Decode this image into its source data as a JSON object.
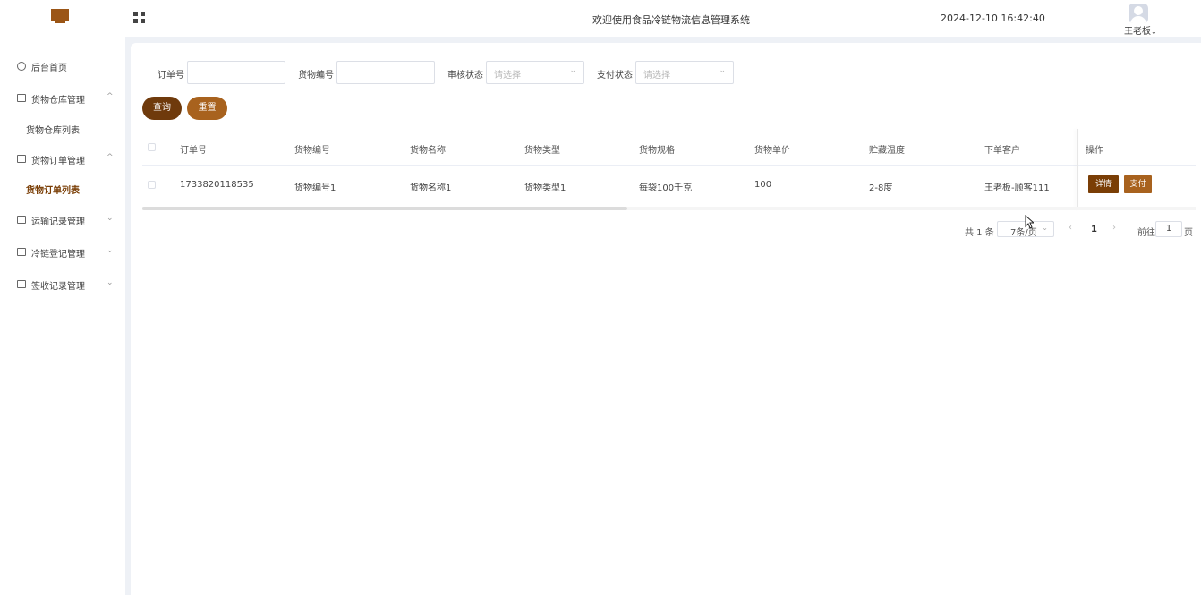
{
  "header": {
    "title": "欢迎使用食品冷链物流信息管理系统",
    "datetime": "2024-12-10 16:42:40",
    "user_name": "王老板",
    "user_caret": "⌄"
  },
  "sidebar": {
    "items": [
      {
        "label": "后台首页",
        "chevron": ""
      },
      {
        "label": "货物仓库管理",
        "chevron": "^"
      },
      {
        "label": "货物仓库列表",
        "chevron": ""
      },
      {
        "label": "货物订单管理",
        "chevron": "^"
      },
      {
        "label": "货物订单列表",
        "chevron": ""
      },
      {
        "label": "运输记录管理",
        "chevron": "⌄"
      },
      {
        "label": "冷链登记管理",
        "chevron": "⌄"
      },
      {
        "label": "签收记录管理",
        "chevron": "⌄"
      }
    ]
  },
  "filters": {
    "order_no_label": "订单号",
    "goods_no_label": "货物编号",
    "audit_label": "审核状态",
    "audit_placeholder": "请选择",
    "pay_label": "支付状态",
    "pay_placeholder": "请选择",
    "query_button": "查询",
    "reset_button": "重置"
  },
  "table": {
    "columns": [
      "订单号",
      "货物编号",
      "货物名称",
      "货物类型",
      "货物规格",
      "货物单价",
      "贮藏温度",
      "下单客户",
      "操作"
    ],
    "rows": [
      {
        "order_no": "1733820118535",
        "goods_no": "货物编号1",
        "goods_name": "货物名称1",
        "goods_type": "货物类型1",
        "goods_spec": "每袋100千克",
        "unit_price": "100",
        "storage_temp": "2-8度",
        "customer": "王老板-顾客111",
        "detail_button": "详情",
        "pay_button": "支付"
      }
    ]
  },
  "pagination": {
    "total_text": "共 1 条",
    "page_size": "7条/页",
    "current_page": "1",
    "goto_label": "前往",
    "goto_value": "1",
    "page_suffix": "页"
  },
  "colors": {
    "brand": "#9b5516",
    "brand_dark": "#7a3e06",
    "query_button": "#6f3a0c",
    "reset_button": "#a8621e"
  }
}
